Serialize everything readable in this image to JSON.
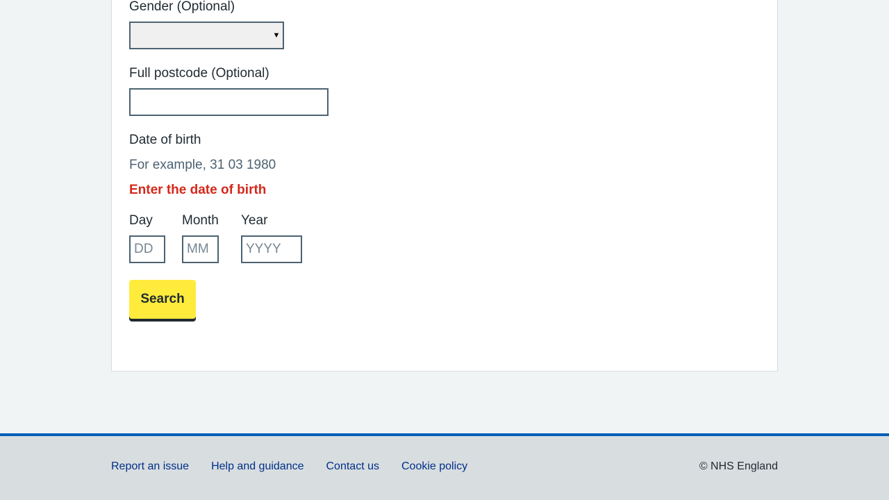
{
  "form": {
    "gender": {
      "label": "Gender (Optional)",
      "selected_value": ""
    },
    "postcode": {
      "label": "Full postcode (Optional)",
      "value": ""
    },
    "date_of_birth": {
      "legend": "Date of birth",
      "hint": "For example, 31 03 1980",
      "error": "Enter the date of birth",
      "day": {
        "label": "Day",
        "placeholder": "DD",
        "value": ""
      },
      "month": {
        "label": "Month",
        "placeholder": "MM",
        "value": ""
      },
      "year": {
        "label": "Year",
        "placeholder": "YYYY",
        "value": ""
      }
    },
    "search_label": "Search"
  },
  "footer": {
    "links": [
      {
        "label": "Report an issue"
      },
      {
        "label": "Help and guidance"
      },
      {
        "label": "Contact us"
      },
      {
        "label": "Cookie policy"
      }
    ],
    "copyright": "© NHS England"
  },
  "colors": {
    "background": "#f0f4f5",
    "card": "#ffffff",
    "error": "#d5281b",
    "button": "#ffeb3b",
    "footer_border": "#005eb8",
    "link": "#003087"
  }
}
